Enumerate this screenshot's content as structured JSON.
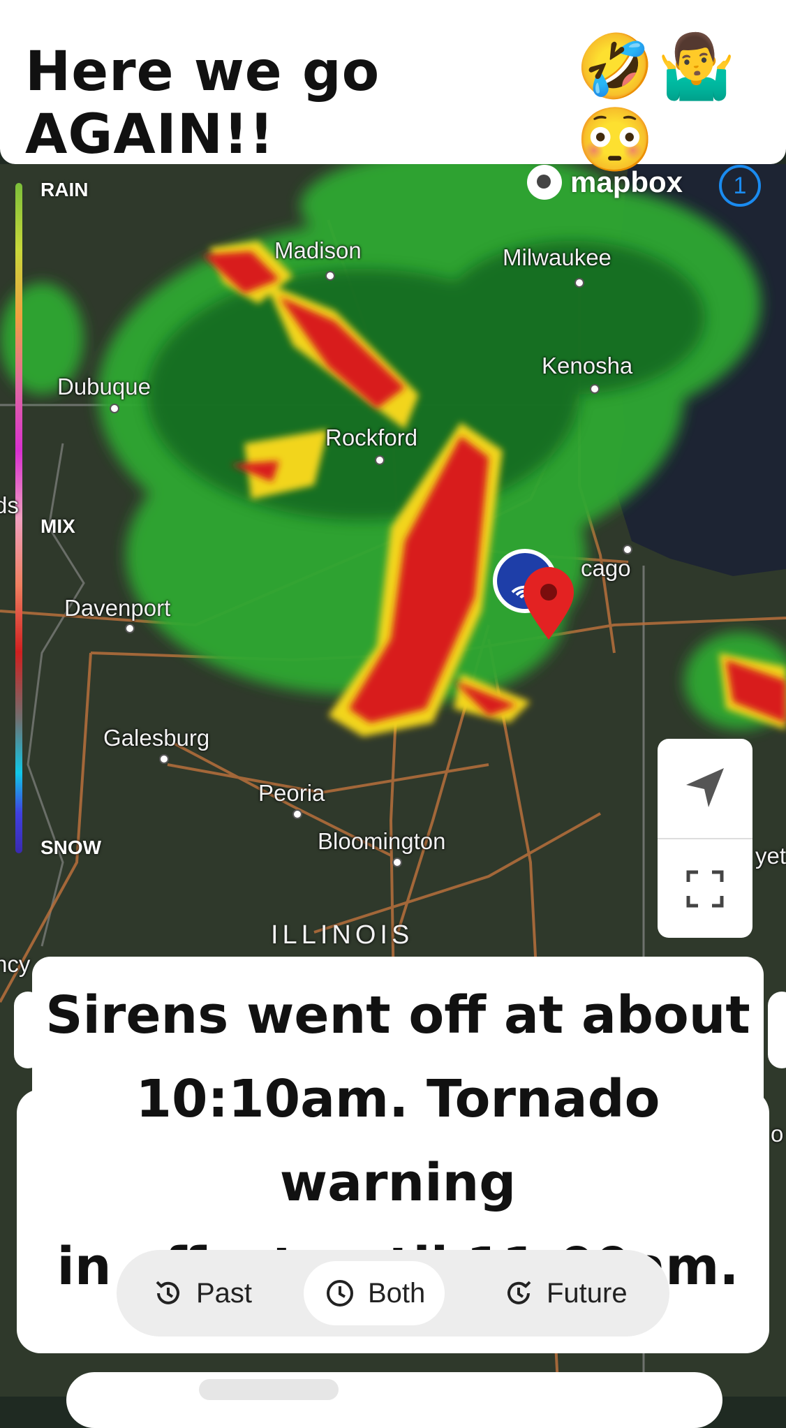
{
  "caption_top": {
    "text": "Here we go AGAIN!!",
    "emoji": "🤣🤷‍♂️😳"
  },
  "legend": {
    "rain": "RAIN",
    "mix": "MIX",
    "snow": "SNOW"
  },
  "map": {
    "attribution": "mapbox",
    "info_count": "1",
    "state_label": "ILLINOIS",
    "cities": [
      {
        "name": "Madison"
      },
      {
        "name": "Milwaukee"
      },
      {
        "name": "Kenosha"
      },
      {
        "name": "Dubuque"
      },
      {
        "name": "Rockford"
      },
      {
        "name": "cago"
      },
      {
        "name": "Davenport"
      },
      {
        "name": "Galesburg"
      },
      {
        "name": "Peoria"
      },
      {
        "name": "Bloomington"
      }
    ],
    "edge_labels": {
      "left_mid": "ds",
      "left_low": "ncy",
      "right_low": "yet",
      "right_lower": "o"
    }
  },
  "caption_bottom": {
    "line1": "Sirens went off at about",
    "line2": "10:10am. Tornado warning",
    "line3": "in  effect until 11:00am."
  },
  "timeline": {
    "past": "Past",
    "both": "Both",
    "future": "Future",
    "selected": "Both"
  },
  "colors": {
    "accent": "#1a8bf0",
    "pin": "#e32222",
    "radar_green": "#2fa832",
    "radar_red": "#d81e1e",
    "radar_yellow": "#f2d51c"
  }
}
